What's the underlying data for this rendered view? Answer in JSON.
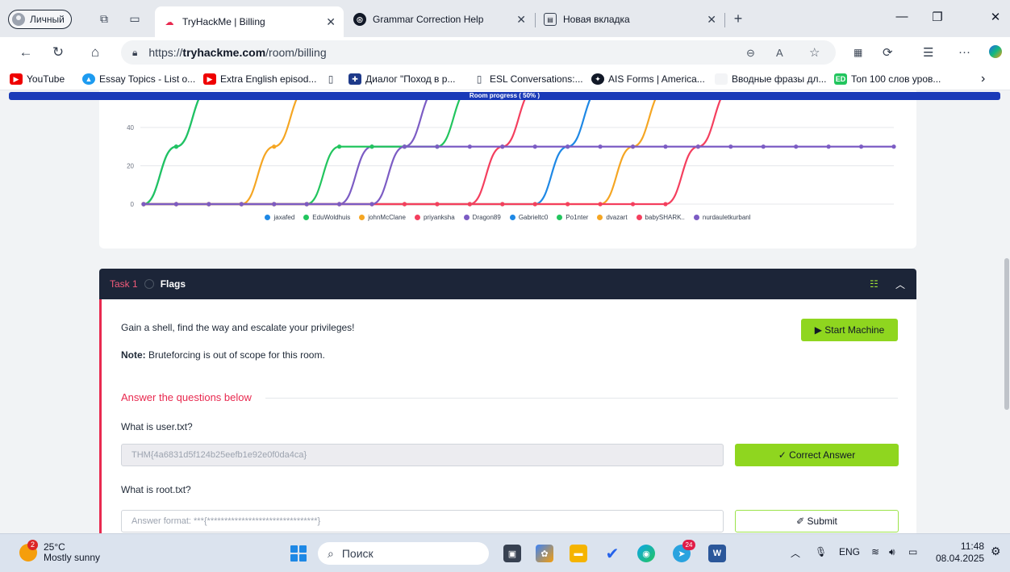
{
  "browser": {
    "profile": "Личный",
    "tabs": [
      {
        "title": "TryHackMe | Billing"
      },
      {
        "title": "Grammar Correction Help"
      },
      {
        "title": "Новая вкладка"
      }
    ],
    "url_prefix": "https://",
    "url_host": "tryhackme.com",
    "url_path": "/room/billing",
    "bookmarks": [
      {
        "label": "YouTube"
      },
      {
        "label": "Essay Topics - List o..."
      },
      {
        "label": "Extra English episod..."
      },
      {
        "label": "Диалог \"Поход в р..."
      },
      {
        "label": "ESL Conversations:..."
      },
      {
        "label": "AIS Forms | America..."
      },
      {
        "label": "Вводные фразы дл..."
      },
      {
        "label": "Топ 100 слов уров..."
      }
    ]
  },
  "room": {
    "progress_label": "Room progress ( 50% )",
    "progress": 0.5
  },
  "chart_data": {
    "type": "line",
    "y_ticks": [
      "40",
      "20",
      "0"
    ],
    "ylim": [
      0,
      60
    ],
    "x_points": 24,
    "series": [
      {
        "name": "jaxafed",
        "color": "#1e88e5",
        "values": [
          0,
          30,
          60,
          60,
          60,
          60,
          60,
          60,
          60,
          60,
          60,
          60,
          60,
          60,
          60,
          60,
          60,
          60,
          60,
          60,
          60,
          60,
          60,
          60
        ]
      },
      {
        "name": "EduWoldhuis",
        "color": "#22c55e",
        "values": [
          0,
          30,
          60,
          60,
          60,
          60,
          60,
          60,
          60,
          60,
          60,
          60,
          60,
          60,
          60,
          60,
          60,
          60,
          60,
          60,
          60,
          60,
          60,
          60
        ]
      },
      {
        "name": "johnMcClane",
        "color": "#f5a623",
        "values": [
          0,
          0,
          0,
          0,
          30,
          60,
          60,
          60,
          60,
          60,
          60,
          60,
          60,
          60,
          60,
          60,
          60,
          60,
          60,
          60,
          60,
          60,
          60,
          60
        ]
      },
      {
        "name": "priyanksha",
        "color": "#f43f5e",
        "values": [
          0,
          0,
          0,
          0,
          0,
          0,
          0,
          0,
          0,
          0,
          0,
          30,
          60,
          60,
          60,
          60,
          60,
          60,
          60,
          60,
          60,
          60,
          60,
          60
        ]
      },
      {
        "name": "Dragon89",
        "color": "#7c5cc4",
        "values": [
          0,
          0,
          0,
          0,
          0,
          0,
          0,
          30,
          30,
          60,
          60,
          60,
          60,
          60,
          60,
          60,
          60,
          60,
          60,
          60,
          60,
          60,
          60,
          60
        ]
      },
      {
        "name": "Gabrieltc0",
        "color": "#1e88e5",
        "values": [
          0,
          0,
          0,
          0,
          0,
          0,
          0,
          0,
          0,
          0,
          0,
          0,
          0,
          30,
          60,
          60,
          60,
          60,
          60,
          60,
          60,
          60,
          60,
          60
        ]
      },
      {
        "name": "Po1nter",
        "color": "#22c55e",
        "values": [
          0,
          0,
          0,
          0,
          0,
          0,
          30,
          30,
          30,
          30,
          60,
          60,
          60,
          60,
          60,
          60,
          60,
          60,
          60,
          60,
          60,
          60,
          60,
          60
        ]
      },
      {
        "name": "dvazart",
        "color": "#f5a623",
        "values": [
          0,
          0,
          0,
          0,
          0,
          0,
          0,
          0,
          0,
          0,
          0,
          0,
          0,
          0,
          0,
          30,
          60,
          60,
          60,
          60,
          60,
          60,
          60,
          60
        ]
      },
      {
        "name": "babySHARK..",
        "color": "#f43f5e",
        "values": [
          0,
          0,
          0,
          0,
          0,
          0,
          0,
          0,
          0,
          0,
          0,
          0,
          0,
          0,
          0,
          0,
          0,
          30,
          60,
          60,
          60,
          60,
          60,
          60
        ]
      },
      {
        "name": "nurdauletkurbanl",
        "color": "#7c5cc4",
        "values": [
          0,
          0,
          0,
          0,
          0,
          0,
          0,
          0,
          30,
          30,
          30,
          30,
          30,
          30,
          30,
          30,
          30,
          30,
          30,
          30,
          30,
          30,
          30,
          30
        ]
      }
    ]
  },
  "task": {
    "number": "Task 1",
    "title": "Flags",
    "description": "Gain a shell, find the way and escalate your privileges!",
    "note_label": "Note:",
    "note_text": " Bruteforcing is out of scope for this room.",
    "start_button": "▶ Start Machine",
    "answers_heading": "Answer the questions below",
    "questions": [
      {
        "question": "What is user.txt?",
        "answer_value": "THM{4a6831d5f124b25eefb1e92e0f0da4ca}",
        "button": "✓ Correct Answer"
      },
      {
        "question": "What is root.txt?",
        "placeholder": "Answer format: ***{********************************}",
        "button": "✐ Submit"
      }
    ]
  },
  "taskbar": {
    "weather_badge": "2",
    "temperature": "25°C",
    "condition": "Mostly sunny",
    "search_placeholder": "Поиск",
    "edge_badge": "24",
    "lang": "ENG",
    "time": "11:48",
    "date": "08.04.2025"
  }
}
